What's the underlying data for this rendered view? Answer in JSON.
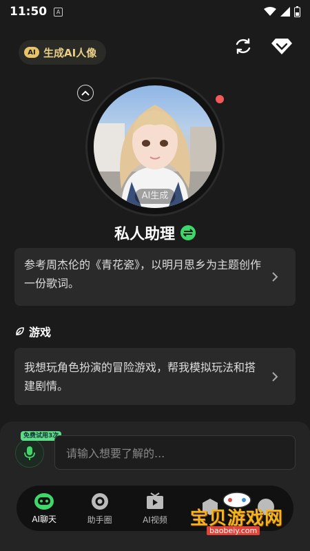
{
  "status_bar": {
    "time": "11:50",
    "a_badge": "A"
  },
  "header": {
    "generate_label": "生成AI人像",
    "ai_badge": "AI"
  },
  "avatar": {
    "tag": "AI生成"
  },
  "assistant": {
    "name": "私人助理"
  },
  "cards": [
    {
      "text": "参考周杰伦的《青花瓷》，以明月思乡为主题创作一份歌词。"
    },
    {
      "text": "我想玩角色扮演的冒险游戏，帮我模拟玩法和搭建剧情。"
    }
  ],
  "section": {
    "title": "游戏"
  },
  "input": {
    "free_tag": "免费试用3次",
    "placeholder": "请输入想要了解的..."
  },
  "tabs": [
    {
      "label": "AI聊天",
      "icon": "robot-icon",
      "active": true
    },
    {
      "label": "助手圈",
      "icon": "circle-icon"
    },
    {
      "label": "AI视频",
      "icon": "video-icon"
    },
    {
      "label": "",
      "icon": "cube-icon"
    },
    {
      "label": "",
      "icon": "profile-icon"
    }
  ],
  "watermark": {
    "text": "宝贝游戏网",
    "url": "baobeiy.com"
  },
  "colors": {
    "accent_green": "#3ed76a",
    "gold": "#e9cf86",
    "background": "#1b1b1b"
  }
}
